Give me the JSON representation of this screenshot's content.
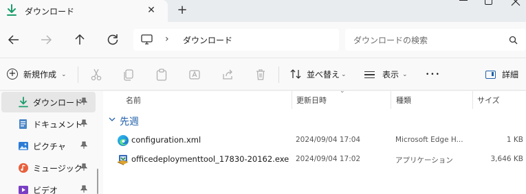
{
  "window": {
    "tab_title": "ダウンロード",
    "tab_icon": "download-folder-icon",
    "close_tab_icon": "close-icon",
    "new_tab_icon": "plus-icon"
  },
  "nav": {
    "back_icon": "arrow-left-icon",
    "forward_icon": "arrow-right-icon",
    "up_icon": "arrow-up-icon",
    "refresh_icon": "refresh-icon",
    "address_separator": "›",
    "address_crumb": "ダウンロード",
    "search_placeholder": "ダウンロードの検索"
  },
  "commands": {
    "new_label": "新規作成",
    "sort_label": "並べ替え",
    "view_label": "表示",
    "more_label": "•••",
    "details_label": "詳細",
    "icons": [
      "cut-icon",
      "copy-icon",
      "paste-icon",
      "rename-icon",
      "share-icon",
      "delete-icon"
    ]
  },
  "sidebar": {
    "items": [
      {
        "label": "ダウンロード",
        "icon": "download-icon",
        "active": true
      },
      {
        "label": "ドキュメント",
        "icon": "document-icon",
        "active": false
      },
      {
        "label": "ピクチャ",
        "icon": "pictures-icon",
        "active": false
      },
      {
        "label": "ミュージック",
        "icon": "music-icon",
        "active": false
      },
      {
        "label": "ビデオ",
        "icon": "video-icon",
        "active": false
      }
    ]
  },
  "columns": {
    "name": "名前",
    "date": "更新日時",
    "type": "種類",
    "size": "サイズ"
  },
  "group": {
    "label": "先週"
  },
  "files": [
    {
      "name": "configuration.xml",
      "date": "2024/09/04 17:04",
      "type": "Microsoft Edge H...",
      "size": "1 KB",
      "icon": "edge-icon"
    },
    {
      "name": "officedeploymenttool_17830-20162.exe",
      "date": "2024/09/04 17:02",
      "type": "アプリケーション",
      "size": "3,646 KB",
      "icon": "installer-icon"
    }
  ],
  "colors": {
    "accent": "#1f5fa8",
    "download_green": "#1a9c6a",
    "selection": "#e6e6e6"
  }
}
